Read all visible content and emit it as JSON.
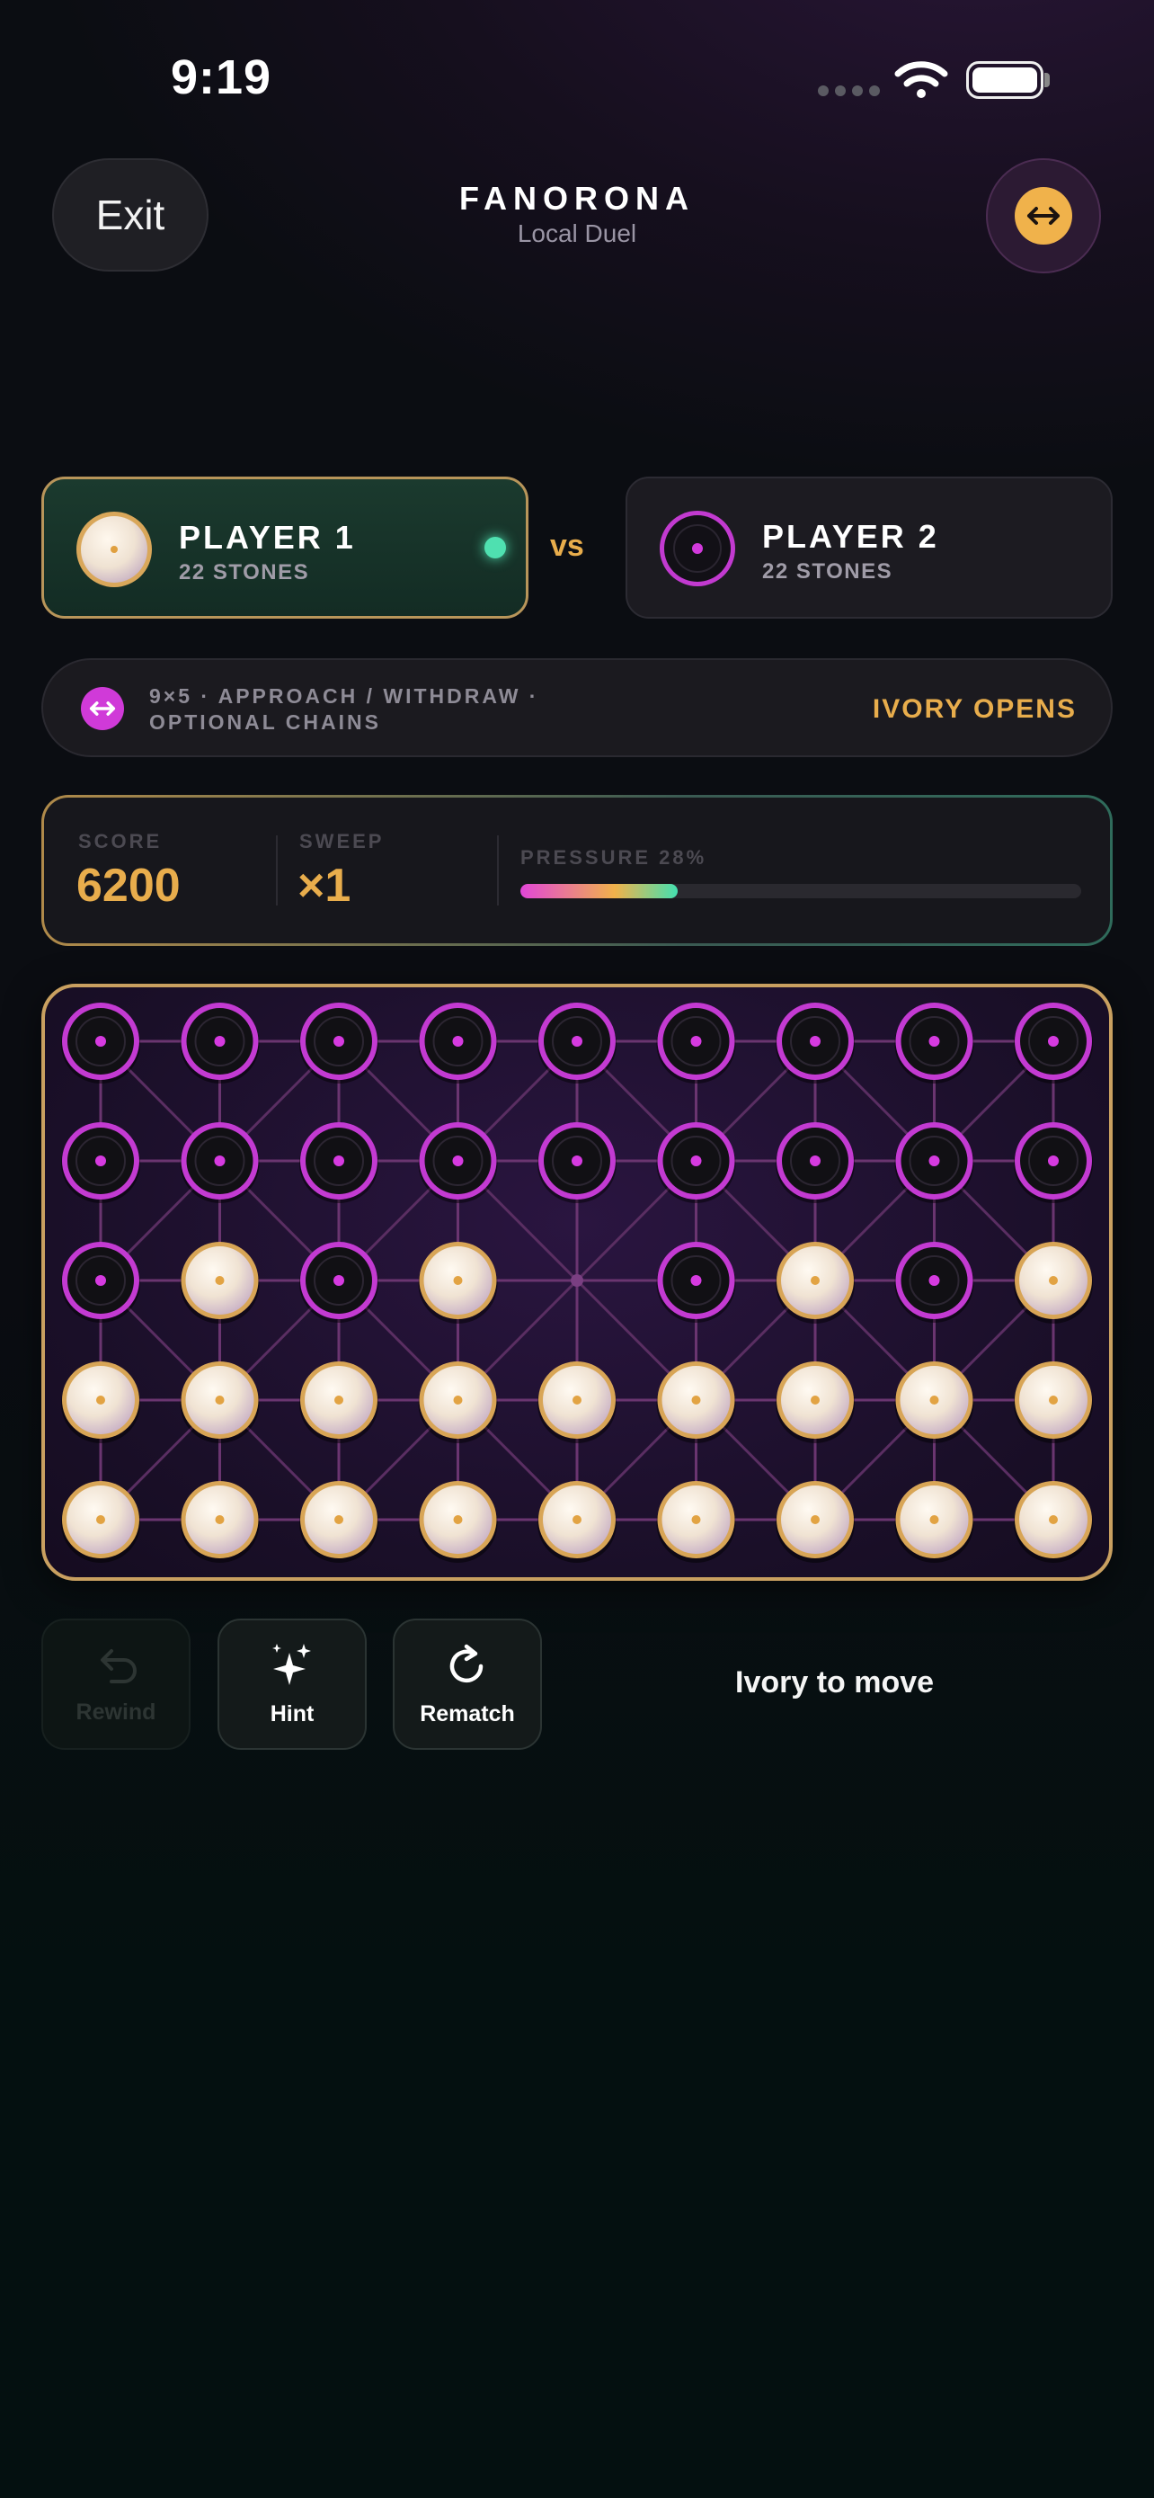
{
  "status_bar": {
    "time": "9:19"
  },
  "header": {
    "exit_label": "Exit",
    "title": "FANORONA",
    "subtitle": "Local Duel",
    "swap_icon": "swap-arrows-icon"
  },
  "players": [
    {
      "name": "PLAYER 1",
      "stones": "22 STONES",
      "color": "ivory",
      "active": true
    },
    {
      "name": "PLAYER 2",
      "stones": "22 STONES",
      "color": "onyx",
      "active": false
    }
  ],
  "vs_label": "vs",
  "rules": {
    "line1": "9×5 · APPROACH / WITHDRAW ·",
    "line2": "OPTIONAL CHAINS",
    "opener": "IVORY OPENS"
  },
  "stats": {
    "score_label": "SCORE",
    "score_value": "6200",
    "sweep_label": "SWEEP",
    "sweep_value": "×1",
    "pressure_label": "PRESSURE 28%",
    "pressure_fraction": 0.28
  },
  "board": {
    "cols": 9,
    "rows": 5,
    "cells": [
      "BBBBBBBBB",
      "BBBBBBBBB",
      "BWBW.BWBW",
      "WWWWWWWWW",
      "WWWWWWWWW"
    ]
  },
  "controls": {
    "rewind_label": "Rewind",
    "hint_label": "Hint",
    "rematch_label": "Rematch"
  },
  "turn_status": "Ivory to move",
  "colors": {
    "accent_gold": "#e8ad4c",
    "accent_magenta": "#d03ad8",
    "active_green": "#4fe0b0"
  }
}
